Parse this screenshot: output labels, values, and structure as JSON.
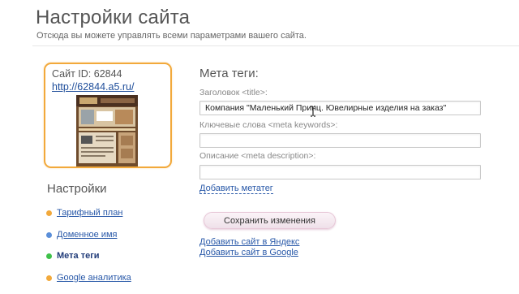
{
  "header": {
    "title": "Настройки сайта",
    "subtitle": "Отсюда вы можете управлять всеми параметрами вашего сайта."
  },
  "site_card": {
    "id_text": "Сайт ID: 62844",
    "url": "http://62844.a5.ru/",
    "accent_color": "#f2a93b"
  },
  "sidebar": {
    "heading": "Настройки",
    "items": [
      {
        "label": "Тарифный план",
        "dot_color": "#f2a93b",
        "active": false
      },
      {
        "label": "Доменное имя",
        "dot_color": "#5b8fd9",
        "active": false
      },
      {
        "label": "Мета теги",
        "dot_color": "#3fc14a",
        "active": true
      },
      {
        "label": "Google аналитика",
        "dot_color": "#f2a93b",
        "active": false
      }
    ]
  },
  "meta_form": {
    "heading": "Мета теги:",
    "title_label": "Заголовок <title>:",
    "title_value": "Компания \"Маленький Принц. Ювелирные изделия на заказ\"",
    "keywords_label": "Ключевые слова <meta keywords>:",
    "keywords_value": "",
    "description_label": "Описание <meta description>:",
    "description_value": "",
    "add_metatag_link": "Добавить метатег",
    "save_button": "Сохранить изменения",
    "add_yandex_link": "Добавить сайт в Яндекс",
    "add_google_link": "Добавить сайт в Google"
  },
  "icons": {
    "cursor": "text-cursor-icon"
  }
}
